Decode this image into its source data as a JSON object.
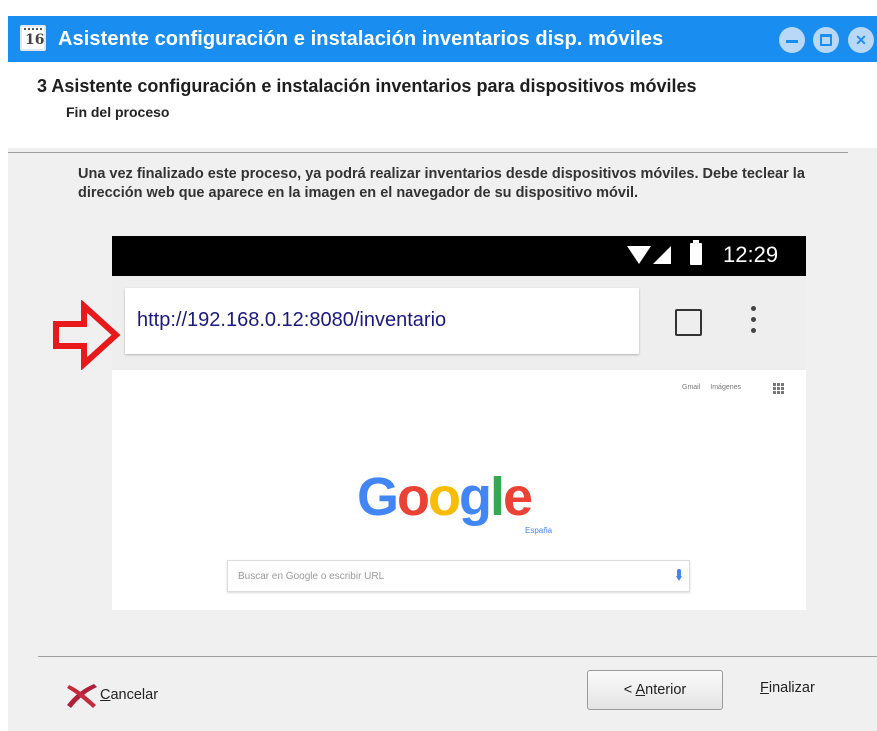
{
  "window": {
    "app_icon_number": "16",
    "title": "Asistente configuración e instalación inventarios disp. móviles",
    "icons": [
      "minimize-icon",
      "maximize-icon",
      "close-icon"
    ]
  },
  "header": {
    "step_title": "3 Asistente configuración e instalación inventarios para dispositivos móviles",
    "step_subtitle": "Fin del proceso"
  },
  "body": {
    "description": "Una vez finalizado este proceso, ya podrá realizar inventarios desde dispositivos móviles. Debe teclear la dirección web que aparece en la imagen en el navegador de su dispositivo móvil.",
    "phone": {
      "status_time": "12:29",
      "url": "http://192.168.0.12:8080/inventario",
      "google_links": [
        "Gmail",
        "Imágenes"
      ],
      "google_logo": [
        "G",
        "o",
        "o",
        "g",
        "l",
        "e"
      ],
      "google_region": "España",
      "search_placeholder": "Buscar en Google o escribir URL"
    }
  },
  "footer": {
    "cancel_prefix": "",
    "cancel_underline": "C",
    "cancel_rest": "ancelar",
    "prev_prefix": "< ",
    "prev_underline": "A",
    "prev_rest": "nterior",
    "finish_underline": "F",
    "finish_rest": "inalizar"
  },
  "colors": {
    "titlebar": "#1a8ef0",
    "arrow": "#e8191b",
    "google_blue": "#4285f4",
    "google_red": "#ea4335",
    "google_yellow": "#fbbc05",
    "google_green": "#34a853"
  }
}
